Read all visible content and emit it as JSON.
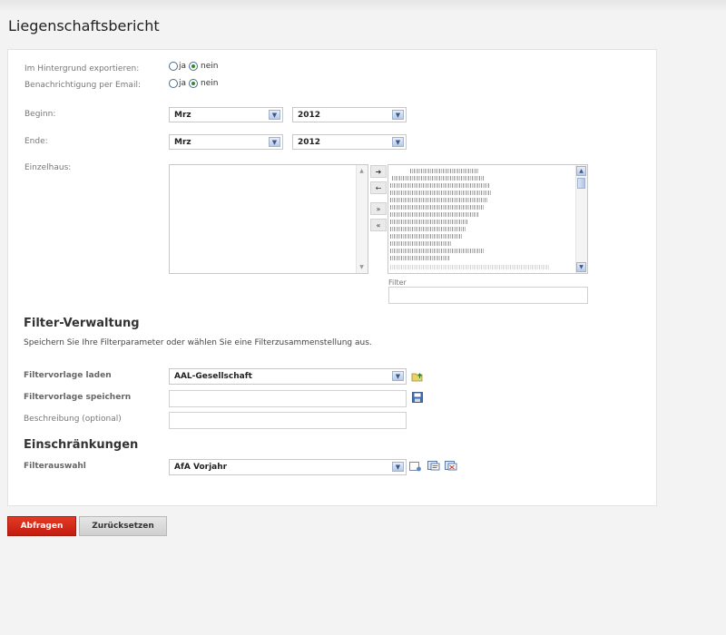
{
  "page": {
    "title": "Liegenschaftsbericht"
  },
  "options": {
    "background_export": {
      "label": "Im Hintergrund exportieren:",
      "yes": "ja",
      "no": "nein",
      "selected": "nein"
    },
    "email_notify": {
      "label": "Benachrichtigung per Email:",
      "yes": "ja",
      "no": "nein",
      "selected": "nein"
    }
  },
  "period": {
    "begin": {
      "label": "Beginn:",
      "month": "Mrz",
      "year": "2012"
    },
    "end": {
      "label": "Ende:",
      "month": "Mrz",
      "year": "2012"
    }
  },
  "einzelhaus": {
    "label": "Einzelhaus:",
    "filter_label": "Filter",
    "filter_value": "",
    "move_buttons": [
      "move-right",
      "move-left",
      "move-all-right",
      "move-all-left"
    ]
  },
  "filter_management": {
    "heading": "Filter-Verwaltung",
    "description": "Speichern Sie Ihre Filterparameter oder wählen Sie eine Filterzusammenstellung aus.",
    "load_label": "Filtervorlage laden",
    "load_value": "AAL-Gesellschaft",
    "save_label": "Filtervorlage speichern",
    "save_value": "",
    "description_label": "Beschreibung (optional)",
    "description_value": ""
  },
  "restrictions": {
    "heading": "Einschränkungen",
    "filter_label": "Filterauswahl",
    "filter_value": "AfA Vorjahr"
  },
  "actions": {
    "submit": "Abfragen",
    "reset": "Zurücksetzen"
  },
  "colors": {
    "primary_button": "#d32a1a",
    "panel_bg": "#ffffff",
    "page_bg": "#f3f3f3"
  }
}
